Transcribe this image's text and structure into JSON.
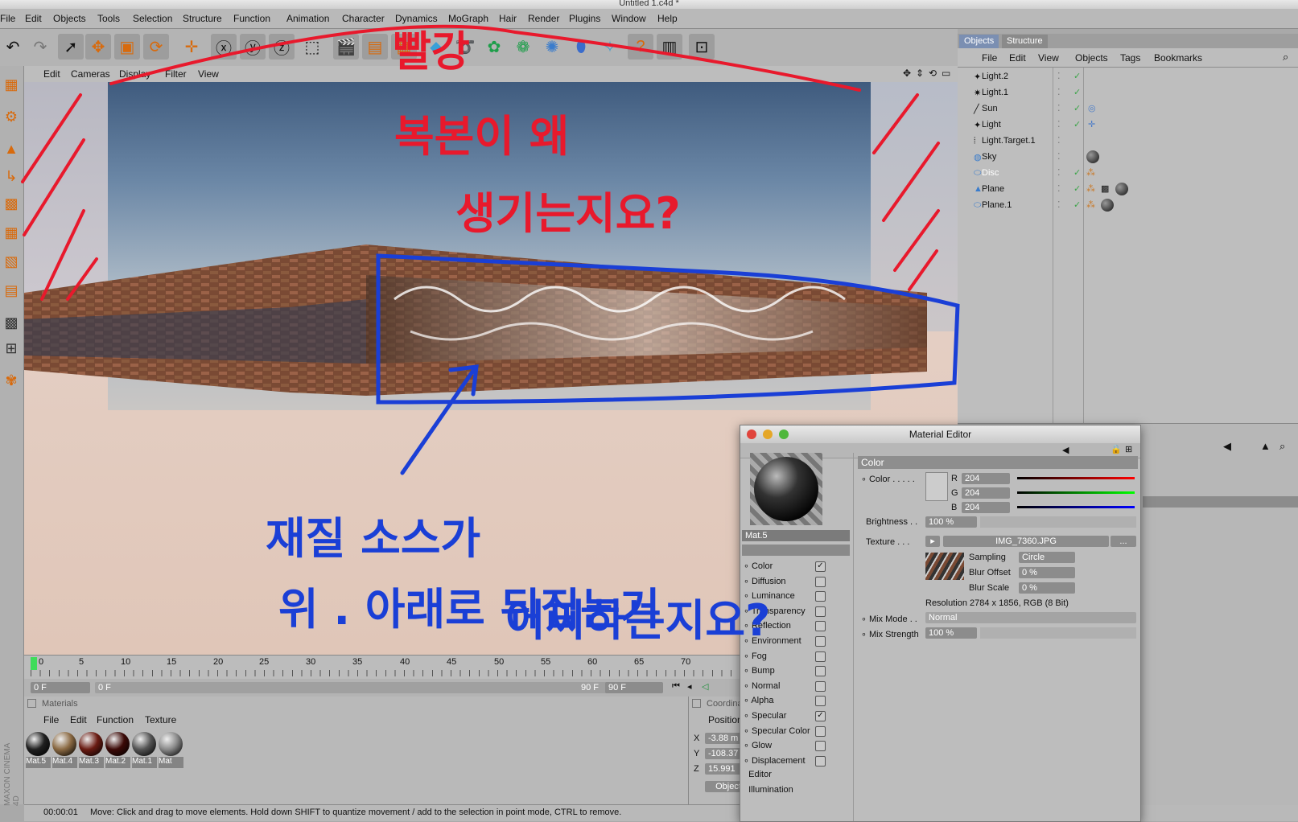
{
  "window": {
    "title": "Untitled 1.c4d *"
  },
  "menubar": {
    "items": [
      "File",
      "Edit",
      "Objects",
      "Tools",
      "Selection",
      "Structure",
      "Function",
      "Animation",
      "Character",
      "Dynamics",
      "MoGraph",
      "Hair",
      "Render",
      "Plugins",
      "Window",
      "Help"
    ]
  },
  "viewport": {
    "menu": [
      "Edit",
      "Cameras",
      "Display",
      "Filter",
      "View"
    ]
  },
  "timeline": {
    "ticks": [
      "0",
      "5",
      "10",
      "15",
      "20",
      "25",
      "30",
      "35",
      "40",
      "45",
      "50",
      "55",
      "60",
      "65",
      "70"
    ],
    "start_field": "0 F",
    "range_start": "0 F",
    "range_end": "90 F",
    "end_field": "90 F"
  },
  "materials": {
    "title": "Materials",
    "menu": [
      "File",
      "Edit",
      "Function",
      "Texture"
    ],
    "items": [
      {
        "label": "Mat.5",
        "color": "#202020"
      },
      {
        "label": "Mat.4",
        "color": "#8b6a43"
      },
      {
        "label": "Mat.3",
        "color": "#6a1b12"
      },
      {
        "label": "Mat.2",
        "color": "#3c0a07"
      },
      {
        "label": "Mat.1",
        "color": "#555555"
      },
      {
        "label": "Mat",
        "color": "#8a8a8a"
      }
    ]
  },
  "coordinates": {
    "title": "Coordinates",
    "position_label": "Position",
    "x_label": "X",
    "x": "-3.88 m",
    "y_label": "Y",
    "y": "-108.37",
    "z_label": "Z",
    "z": "15.991",
    "mode": "Object"
  },
  "status": {
    "time": "00:00:01",
    "message": "Move: Click and drag to move elements. Hold down SHIFT to quantize movement / add to the selection in point mode, CTRL to remove."
  },
  "brand": "MAXON CINEMA 4D",
  "objects_manager": {
    "tabs": [
      "Objects",
      "Structure"
    ],
    "menu": [
      "File",
      "Edit",
      "View",
      "Objects",
      "Tags",
      "Bookmarks"
    ],
    "items": [
      {
        "name": "Light.2"
      },
      {
        "name": "Light.1"
      },
      {
        "name": "Sun"
      },
      {
        "name": "Light"
      },
      {
        "name": "Light.Target.1"
      },
      {
        "name": "Sky"
      },
      {
        "name": "Disc"
      },
      {
        "name": "Plane"
      },
      {
        "name": "Plane.1"
      }
    ]
  },
  "material_editor": {
    "title": "Material Editor",
    "material_name": "Mat.5",
    "section": "Color",
    "color_label": "Color",
    "r_label": "R",
    "r": "204",
    "g_label": "G",
    "g": "204",
    "b_label": "B",
    "b": "204",
    "brightness_label": "Brightness",
    "brightness": "100 %",
    "texture_label": "Texture",
    "texture_file": "IMG_7360.JPG",
    "texture_button": "...",
    "sampling_label": "Sampling",
    "sampling": "Circle",
    "blur_offset_label": "Blur Offset",
    "blur_offset": "0 %",
    "blur_scale_label": "Blur Scale",
    "blur_scale": "0 %",
    "resolution": "Resolution 2784 x 1856, RGB (8 Bit)",
    "mix_mode_label": "Mix Mode",
    "mix_mode": "Normal",
    "mix_strength_label": "Mix Strength",
    "mix_strength": "100 %",
    "channels": [
      {
        "name": "Color",
        "checked": true
      },
      {
        "name": "Diffusion",
        "checked": false
      },
      {
        "name": "Luminance",
        "checked": false
      },
      {
        "name": "Transparency",
        "checked": false
      },
      {
        "name": "Reflection",
        "checked": false
      },
      {
        "name": "Environment",
        "checked": false
      },
      {
        "name": "Fog",
        "checked": false
      },
      {
        "name": "Bump",
        "checked": false
      },
      {
        "name": "Normal",
        "checked": false
      },
      {
        "name": "Alpha",
        "checked": false
      },
      {
        "name": "Specular",
        "checked": true
      },
      {
        "name": "Specular Color",
        "checked": false
      },
      {
        "name": "Glow",
        "checked": false
      },
      {
        "name": "Displacement",
        "checked": false
      },
      {
        "name": "Editor",
        "checked": null
      },
      {
        "name": "Illumination",
        "checked": null
      }
    ]
  },
  "annotations": {
    "red_top": "빨강",
    "red_line1": "복본이 왜",
    "red_line2": "생기는지요?",
    "blue_line1": "재질 소스가",
    "blue_line2": "위 . 아래로 뒤집는거",
    "blue_line3": "어찌하는지요?",
    "red_color": "#e8192c",
    "blue_color": "#1a3fd6"
  }
}
